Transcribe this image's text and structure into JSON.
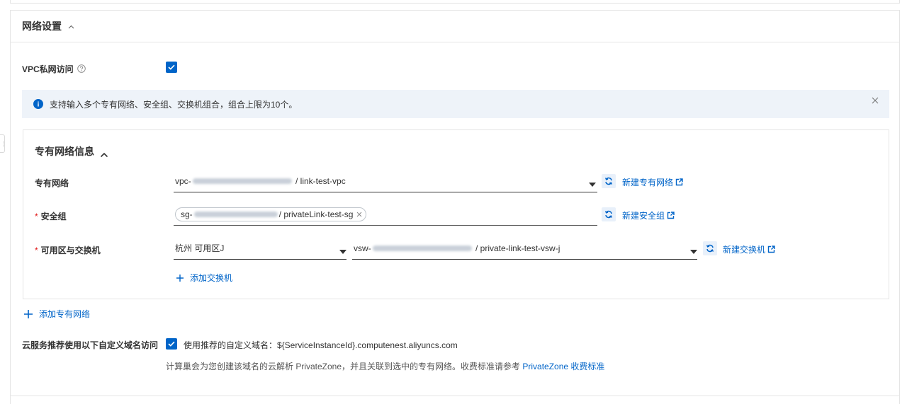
{
  "panel": {
    "title": "网络设置"
  },
  "vpc_access": {
    "label": "VPC私网访问",
    "checked": true
  },
  "alert": {
    "text": "支持输入多个专有网络、安全组、交换机组合，组合上限为10个。"
  },
  "vpc_card": {
    "title": "专有网络信息",
    "vpc": {
      "label": "专有网络",
      "value_prefix": "vpc-",
      "value_suffix": " / link-test-vpc",
      "create_link": "新建专有网络"
    },
    "security_group": {
      "label": "安全组",
      "required_mark": "*",
      "tag_prefix": "sg-",
      "tag_suffix": " / privateLink-test-sg",
      "create_link": "新建安全组"
    },
    "zone_switch": {
      "label": "可用区与交换机",
      "required_mark": "*",
      "zone_value": "杭州 可用区J",
      "switch_prefix": "vsw-",
      "switch_suffix": " / private-link-test-vsw-j",
      "create_link": "新建交换机",
      "add_switch": "添加交换机"
    }
  },
  "add_vpc": "添加专有网络",
  "domain": {
    "label": "云服务推荐使用以下自定义域名访问",
    "checked": true,
    "option_text": "使用推荐的自定义域名：${ServiceInstanceId}.computenest.aliyuncs.com",
    "desc_text": "计算巢会为您创建该域名的云解析 PrivateZone，并且关联到选中的专有网络。收费标准请参考 ",
    "desc_link": "PrivateZone 收费标准"
  },
  "colors": {
    "primary": "#0064c8",
    "required": "#e11414",
    "alert_bg": "#eef3f9"
  }
}
